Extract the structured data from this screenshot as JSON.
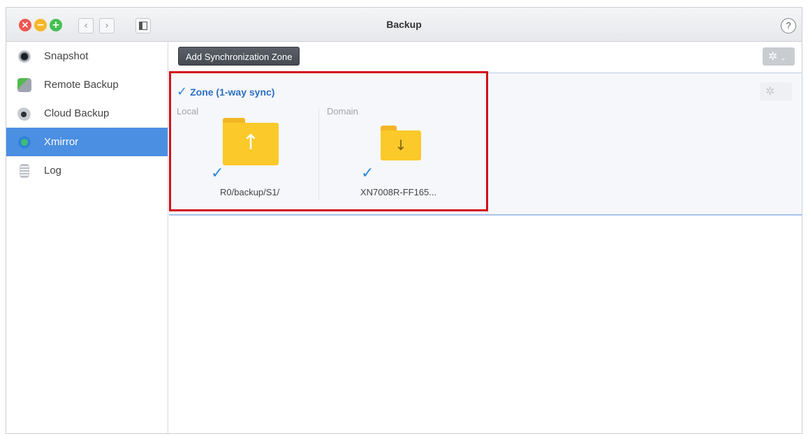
{
  "window": {
    "title": "Backup",
    "controls": {
      "close_glyph": "×",
      "min_glyph": "−",
      "max_glyph": "+",
      "back_glyph": "‹",
      "forward_glyph": "›",
      "help_glyph": "?"
    }
  },
  "sidebar": {
    "items": [
      {
        "label": "Snapshot",
        "icon": "snapshot-icon",
        "active": false
      },
      {
        "label": "Remote Backup",
        "icon": "remote-backup-icon",
        "active": false
      },
      {
        "label": "Cloud Backup",
        "icon": "cloud-backup-icon",
        "active": false
      },
      {
        "label": "Xmirror",
        "icon": "xmirror-icon",
        "active": true
      },
      {
        "label": "Log",
        "icon": "log-icon",
        "active": false
      }
    ]
  },
  "toolbar": {
    "add_zone_label": "Add Synchronization Zone",
    "gear_glyph": "✲",
    "caret_glyph": "⌄"
  },
  "zone": {
    "check_glyph": "✓",
    "title": "Zone (1-way sync)",
    "gear_glyph": "✲",
    "local": {
      "label": "Local",
      "arrow_glyph": "↑",
      "status_glyph": "✓",
      "path": "R0/backup/S1/"
    },
    "domain": {
      "label": "Domain",
      "arrow_glyph": "↓",
      "status_glyph": "✓",
      "path": "XN7008R-FF165..."
    }
  },
  "colors": {
    "active_sidebar": "#4b8fe2",
    "highlight_box": "#d4101a",
    "accent": "#2b87df",
    "folder": "#fbc92a"
  }
}
